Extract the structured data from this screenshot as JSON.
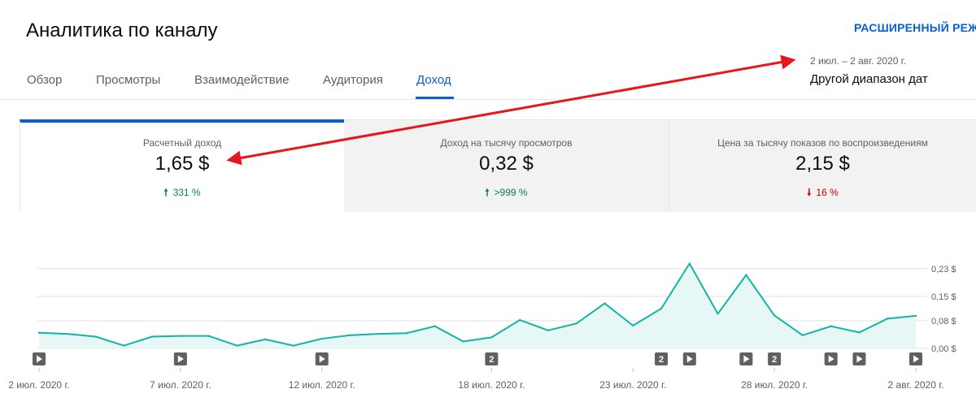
{
  "header": {
    "title": "Аналитика по каналу",
    "advanced_mode": "РАСШИРЕННЫЙ РЕЖИ"
  },
  "tabs": [
    {
      "label": "Обзор",
      "active": false
    },
    {
      "label": "Просмотры",
      "active": false
    },
    {
      "label": "Взаимодействие",
      "active": false
    },
    {
      "label": "Аудитория",
      "active": false
    },
    {
      "label": "Доход",
      "active": true
    }
  ],
  "date_range": {
    "range_text": "2 июл. – 2 авг. 2020 г.",
    "picker_label": "Другой диапазон дат"
  },
  "cards": [
    {
      "label": "Расчетный доход",
      "value": "1,65 $",
      "change": "331 %",
      "direction": "up"
    },
    {
      "label": "Доход на тысячу просмотров",
      "value": "0,32 $",
      "change": ">999 %",
      "direction": "up"
    },
    {
      "label": "Цена за тысячу показов по воспроизведениям",
      "value": "2,15 $",
      "change": "16 %",
      "direction": "down"
    }
  ],
  "colors": {
    "accent": "#065fd4",
    "line": "#12b5a5",
    "area": "#e6f7f5",
    "up": "#0b8043",
    "down": "#cc0000",
    "annotation_arrow": "#e8161b"
  },
  "chart_data": {
    "type": "area",
    "x": [
      "2 июл.",
      "3 июл.",
      "4 июл.",
      "5 июл.",
      "6 июл.",
      "7 июл.",
      "8 июл.",
      "9 июл.",
      "10 июл.",
      "11 июл.",
      "12 июл.",
      "13 июл.",
      "14 июл.",
      "15 июл.",
      "16 июл.",
      "17 июл.",
      "18 июл.",
      "19 июл.",
      "20 июл.",
      "21 июл.",
      "22 июл.",
      "23 июл.",
      "24 июл.",
      "25 июл.",
      "26 июл.",
      "27 июл.",
      "28 июл.",
      "29 июл.",
      "30 июл.",
      "31 июл.",
      "1 авг.",
      "2 авг."
    ],
    "values": [
      0.045,
      0.042,
      0.034,
      0.008,
      0.034,
      0.036,
      0.036,
      0.008,
      0.026,
      0.008,
      0.028,
      0.038,
      0.042,
      0.044,
      0.064,
      0.02,
      0.032,
      0.082,
      0.052,
      0.072,
      0.13,
      0.066,
      0.115,
      0.245,
      0.1,
      0.212,
      0.095,
      0.038,
      0.064,
      0.046,
      0.086,
      0.094
    ],
    "y_ticks": [
      "0,23 $",
      "0,15 $",
      "0,08 $",
      "0,00 $"
    ],
    "y_tick_values": [
      0.23,
      0.15,
      0.08,
      0.0
    ],
    "ylim": [
      0,
      0.265
    ],
    "x_tick_labels": [
      {
        "label": "2 июл. 2020 г.",
        "index": 0
      },
      {
        "label": "7 июл. 2020 г.",
        "index": 5
      },
      {
        "label": "12 июл. 2020 г.",
        "index": 10
      },
      {
        "label": "18 июл. 2020 г.",
        "index": 16
      },
      {
        "label": "23 июл. 2020 г.",
        "index": 21
      },
      {
        "label": "28 июл. 2020 г.",
        "index": 26
      },
      {
        "label": "2 авг. 2020 г.",
        "index": 31
      }
    ],
    "video_markers": [
      {
        "index": 0,
        "kind": "play"
      },
      {
        "index": 5,
        "kind": "play"
      },
      {
        "index": 10,
        "kind": "play"
      },
      {
        "index": 16,
        "kind": "count",
        "count": "2"
      },
      {
        "index": 22,
        "kind": "count",
        "count": "2"
      },
      {
        "index": 23,
        "kind": "play"
      },
      {
        "index": 25,
        "kind": "play"
      },
      {
        "index": 26,
        "kind": "count",
        "count": "2"
      },
      {
        "index": 28,
        "kind": "play"
      },
      {
        "index": 29,
        "kind": "play"
      },
      {
        "index": 31,
        "kind": "play"
      }
    ],
    "grid": true
  }
}
